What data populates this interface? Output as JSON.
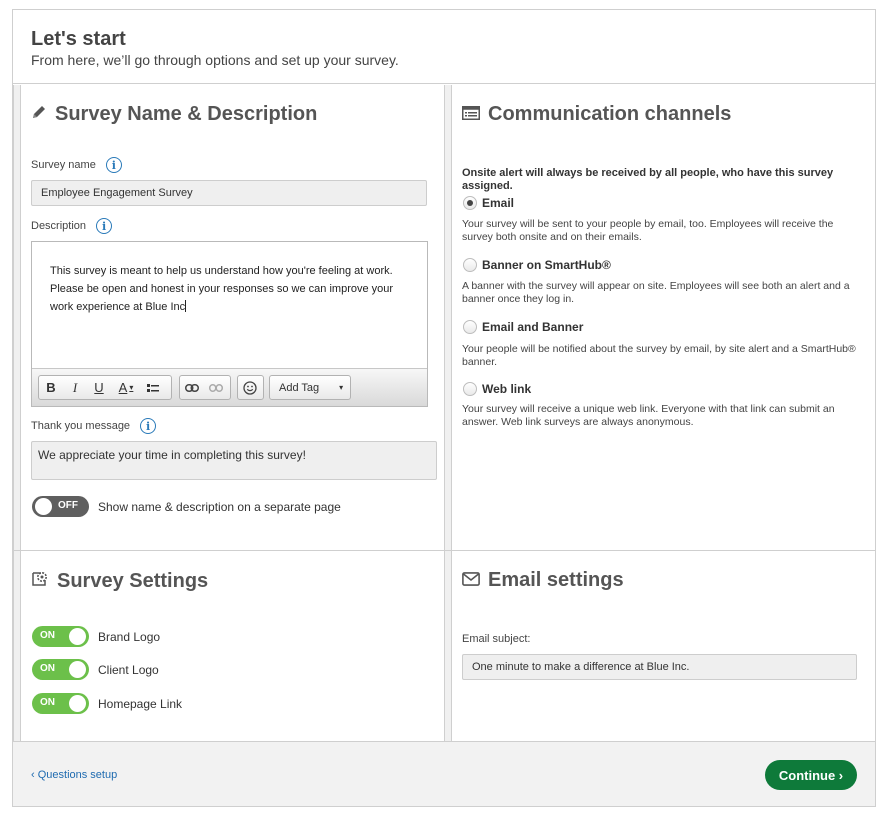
{
  "header": {
    "title": "Let's start",
    "subtitle": "From here, we’ll go through options and set up your survey."
  },
  "survey_name_section": {
    "title": "Survey Name & Description",
    "name_label": "Survey name",
    "name_value": "Employee Engagement Survey",
    "description_label": "Description",
    "description_value": "This survey is meant to help us understand how you're feeling at work. Please be open and honest in your responses so we can improve your work experience at Blue Inc",
    "toolbar": {
      "bold": "B",
      "italic": "I",
      "underline": "U",
      "font_color": "A",
      "add_tag": "Add Tag"
    },
    "thank_you_label": "Thank you message",
    "thank_you_value": "We appreciate your time in completing this survey!",
    "separate_page_toggle": {
      "state": "OFF",
      "label": "Show name & description on a separate page"
    }
  },
  "communication_section": {
    "title": "Communication channels",
    "note": "Onsite alert will always be received by all people, who have this survey assigned.",
    "options": [
      {
        "label": "Email",
        "checked": true,
        "desc": "Your survey will be sent to your people by email, too. Employees will receive the survey both onsite and on their emails."
      },
      {
        "label": "Banner on SmartHub®",
        "checked": false,
        "desc": "A banner with the survey will appear on site. Employees will see both an alert and a banner once they log in."
      },
      {
        "label": "Email and Banner",
        "checked": false,
        "desc": "Your people will be notified about the survey by email, by site alert and a SmartHub® banner."
      },
      {
        "label": "Web link",
        "checked": false,
        "desc": "Your survey will receive a unique web link. Everyone with that link can submit an answer. Web link surveys are always anonymous."
      }
    ]
  },
  "survey_settings_section": {
    "title": "Survey Settings",
    "toggles": [
      {
        "state": "ON",
        "label": "Brand Logo"
      },
      {
        "state": "ON",
        "label": "Client Logo"
      },
      {
        "state": "ON",
        "label": "Homepage Link"
      }
    ]
  },
  "email_settings_section": {
    "title": "Email settings",
    "subject_label": "Email subject:",
    "subject_value": "One minute to make a difference at Blue Inc."
  },
  "footer": {
    "back_label": "‹ Questions setup",
    "continue_label": "Continue ›"
  },
  "colors": {
    "toggle_on": "#6cc04a",
    "toggle_off": "#5f5f5f",
    "continue_button": "#0e7a3a",
    "link": "#1f6bb0",
    "info_icon": "#2a7ab9"
  }
}
